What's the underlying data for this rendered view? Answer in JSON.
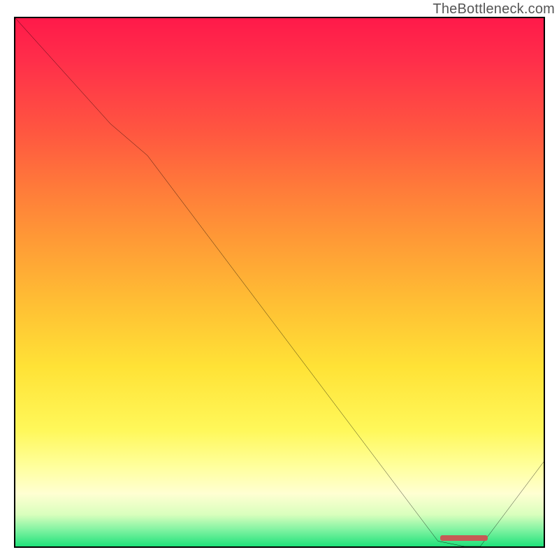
{
  "watermark": "TheBottleneck.com",
  "chart_data": {
    "type": "line",
    "title": "",
    "xlabel": "",
    "ylabel": "",
    "xlim": [
      0,
      100
    ],
    "ylim": [
      0,
      100
    ],
    "x": [
      0,
      18,
      25,
      80,
      85,
      88,
      100
    ],
    "values": [
      100,
      80,
      74,
      1,
      0,
      0,
      16
    ],
    "note": "Values are normalized percentages read off the plot; the y-axis runs 0→100 bottom→top and the curve starts at the top-left, descends to a minimum around x≈82-88 near y≈0, then rises toward the right edge.",
    "background_gradient": {
      "direction": "vertical",
      "stops": [
        {
          "pos": 0.0,
          "color": "#ff1a4a"
        },
        {
          "pos": 0.22,
          "color": "#ff5840"
        },
        {
          "pos": 0.42,
          "color": "#ff9a36"
        },
        {
          "pos": 0.66,
          "color": "#ffe236"
        },
        {
          "pos": 0.85,
          "color": "#ffff9e"
        },
        {
          "pos": 0.97,
          "color": "#7cf2a0"
        },
        {
          "pos": 1.0,
          "color": "#20e27a"
        }
      ]
    },
    "marker": {
      "x_start": 80,
      "x_end": 89,
      "y": 1,
      "color": "#c65a55"
    }
  }
}
